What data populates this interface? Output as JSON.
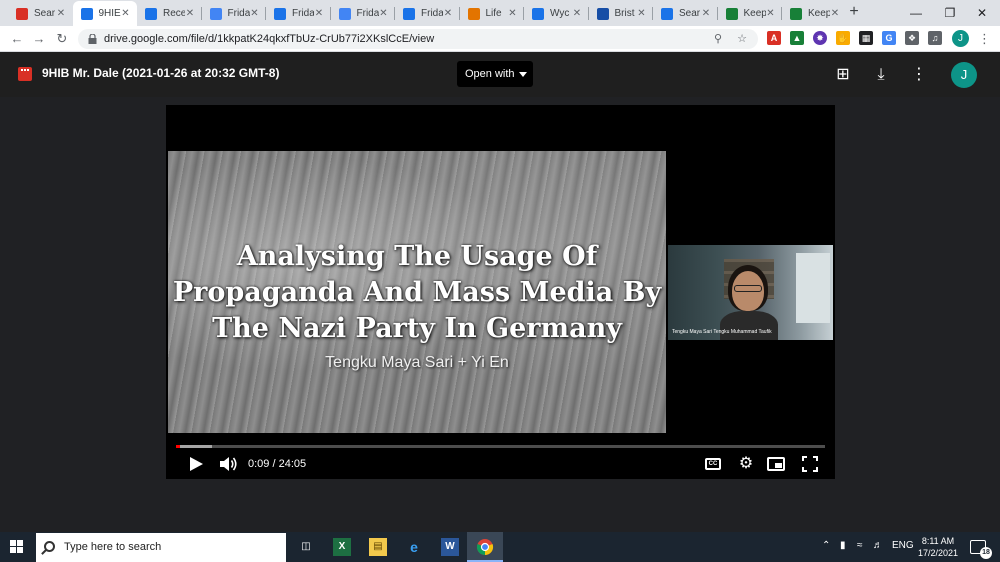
{
  "tabs": [
    {
      "title": "Sear",
      "icon": "gmail-icon",
      "color": "#d93025"
    },
    {
      "title": "9HIE",
      "icon": "google-drive-icon",
      "color": "#1a73e8",
      "active": true
    },
    {
      "title": "Rece",
      "icon": "google-drive-icon",
      "color": "#1a73e8"
    },
    {
      "title": "Frida",
      "icon": "google-docs-icon",
      "color": "#4285f4"
    },
    {
      "title": "Frida",
      "icon": "google-drive-icon",
      "color": "#1a73e8"
    },
    {
      "title": "Frida",
      "icon": "google-docs-icon",
      "color": "#4285f4"
    },
    {
      "title": "Frida",
      "icon": "google-drive-icon",
      "color": "#1a73e8"
    },
    {
      "title": "Life",
      "icon": "orange-person-icon",
      "color": "#e37400"
    },
    {
      "title": "Wyc",
      "icon": "blue-bars-icon",
      "color": "#1a73e8"
    },
    {
      "title": "Brist",
      "icon": "b-square-icon",
      "color": "#174ea6"
    },
    {
      "title": "Sear",
      "icon": "google-drive-icon",
      "color": "#1a73e8"
    },
    {
      "title": "Keep",
      "icon": "green-plus-icon",
      "color": "#188038"
    },
    {
      "title": "Keep",
      "icon": "green-plus-icon",
      "color": "#188038"
    }
  ],
  "address": {
    "url": "drive.google.com/file/d/1kkpatK24qkxfTbUz-CrUb77i2XKslCcE/view"
  },
  "viewer": {
    "file_title": "9HIB Mr. Dale (2021-01-26 at 20:32 GMT-8)",
    "open_with_label": "Open with",
    "profile_initial": "J"
  },
  "video": {
    "slide_title_lines": [
      "Analysing The Usage Of",
      "Propaganda And Mass Media By",
      "The Nazi Party In Germany"
    ],
    "slide_subtitle": "Tengku Maya Sari + Yi En",
    "participant_label": "Tengku Maya Sari Tengku Muhammad Taufik",
    "timecode": "0:09 / 24:05",
    "progress_played_fraction": 0.006,
    "progress_loaded_fraction": 0.055,
    "cc_label": "CC"
  },
  "taskbar": {
    "search_placeholder": "Type here to search",
    "language": "ENG",
    "time": "8:11 AM",
    "date": "17/2/2021",
    "notification_count": "18"
  }
}
